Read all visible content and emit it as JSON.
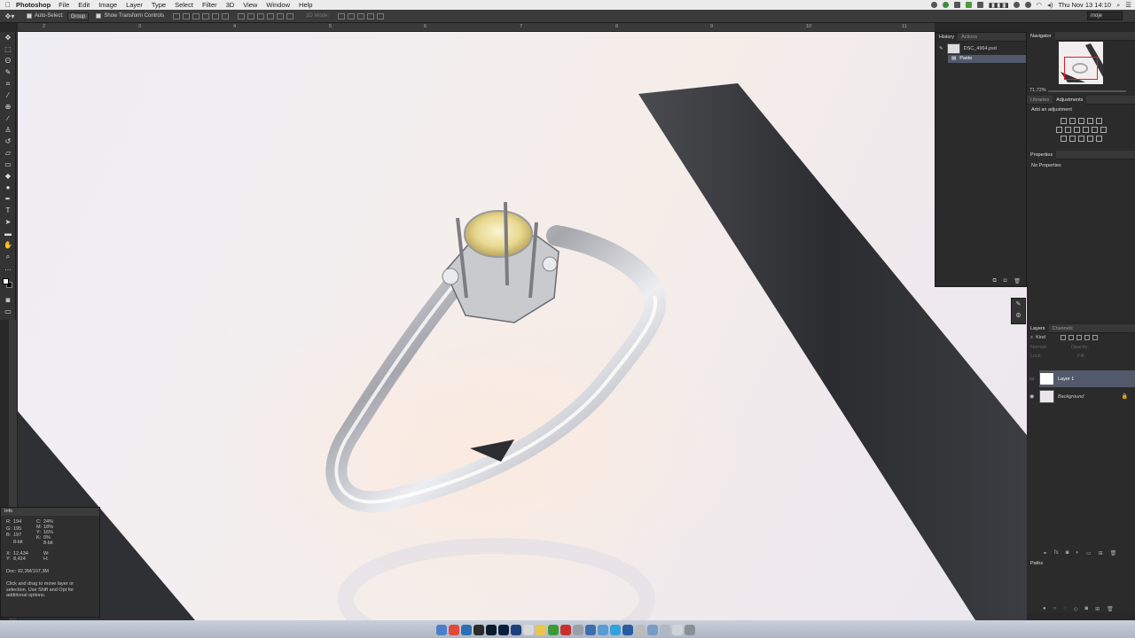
{
  "menubar": {
    "app_name": "Photoshop",
    "menus": [
      "File",
      "Edit",
      "Image",
      "Layer",
      "Type",
      "Select",
      "Filter",
      "3D",
      "View",
      "Window",
      "Help"
    ],
    "clock": "Thu Nov 13  14:10"
  },
  "options_bar": {
    "auto_select_label": "Auto-Select:",
    "auto_select_value": "Group",
    "transform_label": "Show Transform Controls",
    "mode_3d_label": "3D Mode:",
    "workspace": "moje"
  },
  "ruler": {
    "ticks": [
      "2",
      "3",
      "4",
      "5",
      "6",
      "7",
      "8",
      "9",
      "10",
      "11"
    ]
  },
  "history": {
    "tabs": [
      "History",
      "Actions"
    ],
    "snapshot": "DSC_4964.psd",
    "steps": [
      "Paste"
    ]
  },
  "navigator": {
    "tab": "Navigator",
    "zoom": "71,72%"
  },
  "adjustments": {
    "tabs": [
      "Libraries",
      "Adjustments"
    ],
    "title": "Add an adjustment"
  },
  "properties": {
    "tab": "Properties",
    "message": "No Properties"
  },
  "layers": {
    "tabs": [
      "Layers",
      "Channels"
    ],
    "filter_kind": "Kind",
    "blend_mode": "Normal",
    "opacity_label": "Opacity:",
    "lock_label": "Lock:",
    "fill_label": "Fill:",
    "items": [
      {
        "name": "Layer 1",
        "selected": true
      },
      {
        "name": "Background",
        "selected": false
      }
    ]
  },
  "paths": {
    "tab": "Paths"
  },
  "info": {
    "tab": "Info",
    "rgb": [
      [
        "R:",
        "194"
      ],
      [
        "G:",
        "195"
      ],
      [
        "B:",
        "197"
      ]
    ],
    "cmyk": [
      [
        "C:",
        "24%"
      ],
      [
        "M:",
        "18%"
      ],
      [
        "Y:",
        "16%"
      ],
      [
        "K:",
        "0%"
      ]
    ],
    "bit_left": "8-bit",
    "bit_right": "8-bit",
    "xy": [
      [
        "X:",
        "12,434"
      ],
      [
        "Y:",
        "8,424"
      ]
    ],
    "wh": [
      [
        "W:",
        ""
      ],
      [
        "H:",
        ""
      ]
    ],
    "doc": "Doc: 92,3M/107,3M",
    "hint": "Click and drag to move layer or selection. Use Shift and Opt for additional options."
  },
  "colors": {
    "selection": "#51596a",
    "panel": "#2b2b2b",
    "nav_view_box": "#e02020"
  }
}
